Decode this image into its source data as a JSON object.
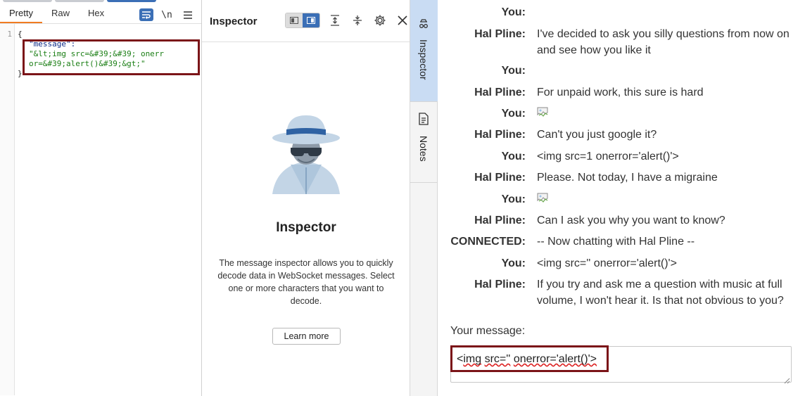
{
  "editor": {
    "tabs": [
      "Pretty",
      "Raw",
      "Hex"
    ],
    "newline_toggle": "\\n",
    "line_numbers": [
      "1"
    ],
    "code": {
      "open_brace": "{",
      "key": "\"message\":",
      "value_line1": "\"&lt;img src=&#39;&#39; onerr",
      "value_line2": "or=&#39;alert()&#39;&gt;\"",
      "close_brace": "}"
    }
  },
  "inspector": {
    "title": "Inspector",
    "heading": "Inspector",
    "description": "The message inspector allows you to quickly decode data in WebSocket messages. Select one or more characters that you want to decode.",
    "learn_more": "Learn more"
  },
  "side_tabs": [
    "Inspector",
    "Notes"
  ],
  "chat": {
    "messages": [
      {
        "sender": "You:",
        "text": ""
      },
      {
        "sender": "Hal Pline:",
        "text": "I've decided to ask you silly questions from now on and see how you like it"
      },
      {
        "sender": "You:",
        "text": ""
      },
      {
        "sender": "Hal Pline:",
        "text": "For unpaid work, this sure is hard"
      },
      {
        "sender": "You:",
        "text": "",
        "broken_image": true
      },
      {
        "sender": "Hal Pline:",
        "text": "Can't you just google it?"
      },
      {
        "sender": "You:",
        "text": "<img src=1 onerror='alert()'>"
      },
      {
        "sender": "Hal Pline:",
        "text": "Please. Not today, I have a migraine"
      },
      {
        "sender": "You:",
        "text": "",
        "broken_image": true
      },
      {
        "sender": "Hal Pline:",
        "text": "Can I ask you why you want to know?"
      },
      {
        "sender": "CONNECTED:",
        "text": "-- Now chatting with Hal Pline --"
      },
      {
        "sender": "You:",
        "text": "<img src='' onerror='alert()'>"
      },
      {
        "sender": "Hal Pline:",
        "text": "If you try and ask me a question with music at full volume, I won't hear it. Is that not obvious to you?"
      }
    ],
    "your_message_label": "Your message:",
    "input_value": "<img src='' onerror='alert()'>",
    "input_parts": [
      "<",
      "img",
      " ",
      "src=''",
      " ",
      "onerror='alert()'>"
    ]
  },
  "colors": {
    "accent": "#3b6fb6",
    "highlight_box": "#7b1418",
    "active_tab_underline": "#f07c22",
    "json_key": "#0d2a87",
    "json_string": "#1a7e14"
  }
}
